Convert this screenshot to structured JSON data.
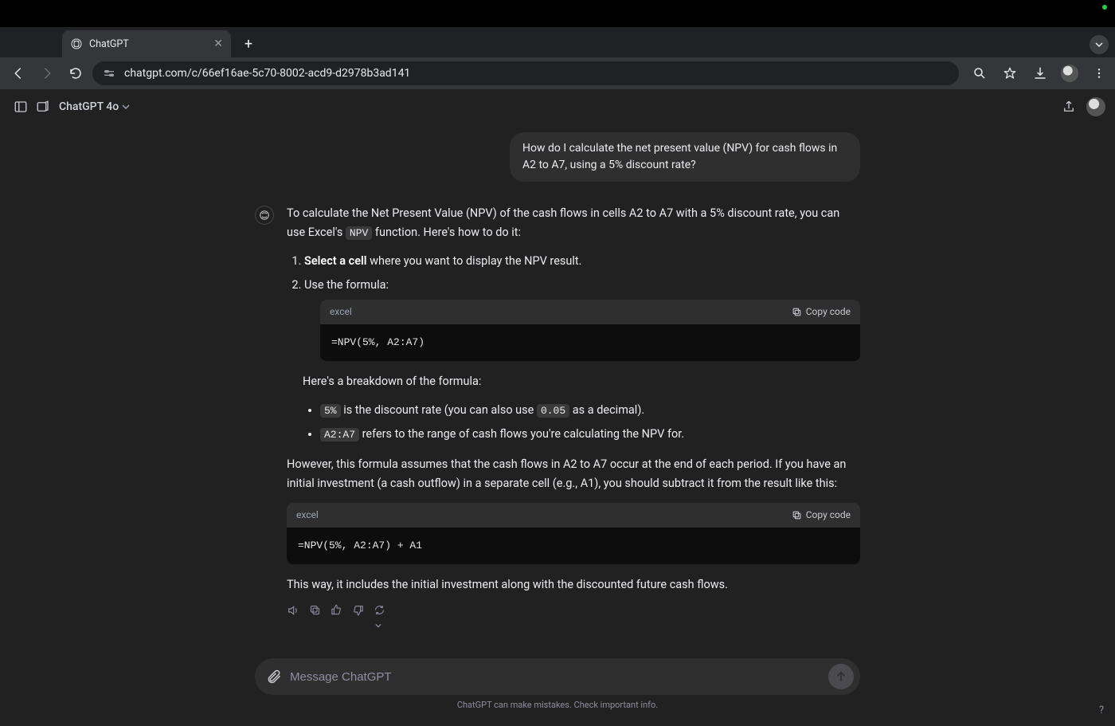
{
  "browser": {
    "tab_title": "ChatGPT",
    "url": "chatgpt.com/c/66ef16ae-5c70-8002-acd9-d2978b3ad141"
  },
  "app_header": {
    "model": "ChatGPT 4o"
  },
  "conversation": {
    "user_message": "How do I calculate the net present value (NPV) for cash flows in A2 to A7, using a 5% discount rate?",
    "assistant": {
      "intro_part1": "To calculate the Net Present Value (NPV) of the cash flows in cells A2 to A7 with a 5% discount rate, you can use Excel's ",
      "intro_code": "NPV",
      "intro_part2": " function. Here's how to do it:",
      "step1_bold": "Select a cell",
      "step1_rest": " where you want to display the NPV result.",
      "step2": "Use the formula:",
      "code1_lang": "excel",
      "copy_label": "Copy code",
      "code1_body": "=NPV(5%, A2:A7)",
      "breakdown_intro": "Here's a breakdown of the formula:",
      "bullet1_code": "5%",
      "bullet1_mid": " is the discount rate (you can also use ",
      "bullet1_code2": "0.05",
      "bullet1_end": " as a decimal).",
      "bullet2_code": "A2:A7",
      "bullet2_text": " refers to the range of cash flows you're calculating the NPV for.",
      "however": "However, this formula assumes that the cash flows in A2 to A7 occur at the end of each period. If you have an initial investment (a cash outflow) in a separate cell (e.g., A1), you should subtract it from the result like this:",
      "code2_lang": "excel",
      "code2_body": "=NPV(5%, A2:A7) + A1",
      "closing": "This way, it includes the initial investment along with the discounted future cash flows."
    }
  },
  "composer": {
    "placeholder": "Message ChatGPT"
  },
  "footer": {
    "disclaimer": "ChatGPT can make mistakes. Check important info.",
    "help": "?"
  }
}
